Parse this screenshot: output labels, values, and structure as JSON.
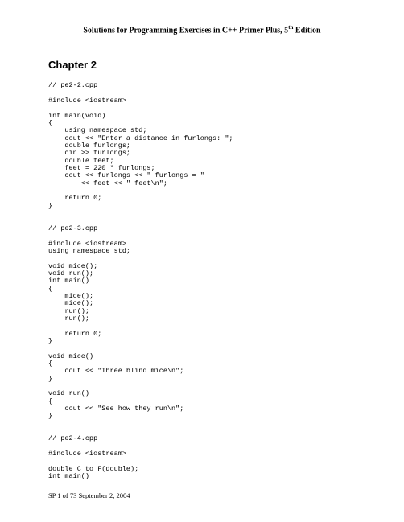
{
  "header": {
    "title_prefix": "Solutions for Programming Exercises in C++ Primer Plus, 5",
    "title_sup": "th",
    "title_suffix": " Edition"
  },
  "chapter": {
    "title": "Chapter 2"
  },
  "code": "// pe2-2.cpp\n\n#include <iostream>\n\nint main(void)\n{\n    using namespace std;\n    cout << \"Enter a distance in furlongs: \";\n    double furlongs;\n    cin >> furlongs;\n    double feet;\n    feet = 220 * furlongs;\n    cout << furlongs << \" furlongs = \"\n        << feet << \" feet\\n\";\n\n    return 0;\n}\n\n\n// pe2-3.cpp\n\n#include <iostream>\nusing namespace std;\n\nvoid mice();\nvoid run();\nint main()\n{\n    mice();\n    mice();\n    run();\n    run();\n\n    return 0;\n}\n\nvoid mice()\n{\n    cout << \"Three blind mice\\n\";\n}\n\nvoid run()\n{\n    cout << \"See how they run\\n\";\n}\n\n\n// pe2-4.cpp\n\n#include <iostream>\n\ndouble C_to_F(double);\nint main()",
  "footer": {
    "text": "SP   1 of 73   September 2, 2004"
  }
}
